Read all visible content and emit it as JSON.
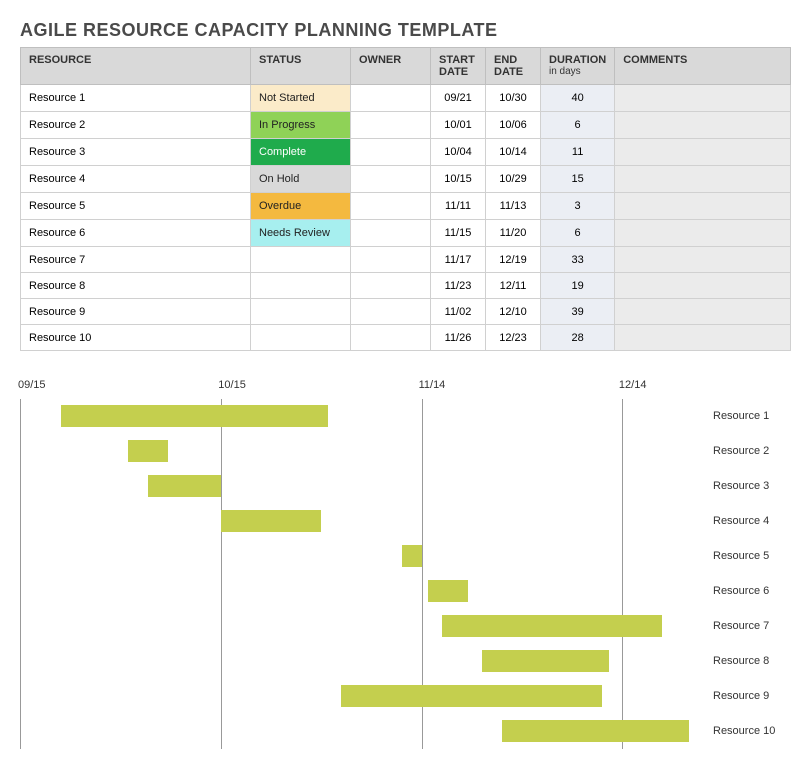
{
  "title": "AGILE RESOURCE CAPACITY PLANNING TEMPLATE",
  "headers": {
    "resource": "RESOURCE",
    "status": "STATUS",
    "owner": "OWNER",
    "start": "START DATE",
    "end": "END DATE",
    "duration": "DURATION",
    "duration_sub": "in days",
    "comments": "COMMENTS"
  },
  "status_colors": {
    "Not Started": "#fbebc9",
    "In Progress": "#8fd257",
    "Complete": "#1fab4c",
    "On Hold": "#d9d9d9",
    "Overdue": "#f4b93f",
    "Needs Review": "#a7efef"
  },
  "rows": [
    {
      "resource": "Resource 1",
      "status": "Not Started",
      "owner": "",
      "start": "09/21",
      "end": "10/30",
      "duration": "40",
      "comments": ""
    },
    {
      "resource": "Resource 2",
      "status": "In Progress",
      "owner": "",
      "start": "10/01",
      "end": "10/06",
      "duration": "6",
      "comments": ""
    },
    {
      "resource": "Resource 3",
      "status": "Complete",
      "owner": "",
      "start": "10/04",
      "end": "10/14",
      "duration": "11",
      "comments": ""
    },
    {
      "resource": "Resource 4",
      "status": "On Hold",
      "owner": "",
      "start": "10/15",
      "end": "10/29",
      "duration": "15",
      "comments": ""
    },
    {
      "resource": "Resource 5",
      "status": "Overdue",
      "owner": "",
      "start": "11/11",
      "end": "11/13",
      "duration": "3",
      "comments": ""
    },
    {
      "resource": "Resource 6",
      "status": "Needs Review",
      "owner": "",
      "start": "11/15",
      "end": "11/20",
      "duration": "6",
      "comments": ""
    },
    {
      "resource": "Resource 7",
      "status": "",
      "owner": "",
      "start": "11/17",
      "end": "12/19",
      "duration": "33",
      "comments": ""
    },
    {
      "resource": "Resource 8",
      "status": "",
      "owner": "",
      "start": "11/23",
      "end": "12/11",
      "duration": "19",
      "comments": ""
    },
    {
      "resource": "Resource 9",
      "status": "",
      "owner": "",
      "start": "11/02",
      "end": "12/10",
      "duration": "39",
      "comments": ""
    },
    {
      "resource": "Resource 10",
      "status": "",
      "owner": "",
      "start": "11/26",
      "end": "12/23",
      "duration": "28",
      "comments": ""
    }
  ],
  "chart_data": {
    "type": "bar",
    "orientation": "horizontal-gantt",
    "title": "",
    "x_axis_dates": [
      "09/15",
      "10/15",
      "11/14",
      "12/14"
    ],
    "x_range_days": [
      0,
      99
    ],
    "bar_color": "#c4cf4e",
    "series": [
      {
        "name": "Resource 1",
        "start_offset": 6,
        "duration": 40
      },
      {
        "name": "Resource 2",
        "start_offset": 16,
        "duration": 6
      },
      {
        "name": "Resource 3",
        "start_offset": 19,
        "duration": 11
      },
      {
        "name": "Resource 4",
        "start_offset": 30,
        "duration": 15
      },
      {
        "name": "Resource 5",
        "start_offset": 57,
        "duration": 3
      },
      {
        "name": "Resource 6",
        "start_offset": 61,
        "duration": 6
      },
      {
        "name": "Resource 7",
        "start_offset": 63,
        "duration": 33
      },
      {
        "name": "Resource 8",
        "start_offset": 69,
        "duration": 19
      },
      {
        "name": "Resource 9",
        "start_offset": 48,
        "duration": 39
      },
      {
        "name": "Resource 10",
        "start_offset": 72,
        "duration": 28
      }
    ]
  }
}
